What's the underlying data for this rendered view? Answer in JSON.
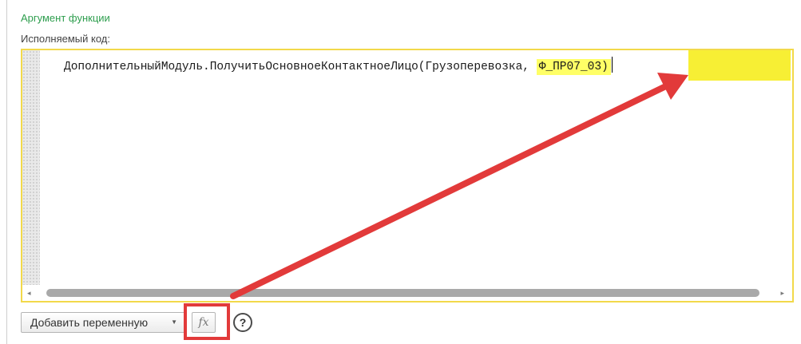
{
  "group_title": "Аргумент функции",
  "field_label": "Исполняемый код:",
  "editor": {
    "code_before": "ДополнительныйМодуль.ПолучитьОсновноеКонтактноеЛицо(Грузоперевозка, ",
    "code_highlight": "Ф_ПР07_03)"
  },
  "scrollbar": {
    "left_arrow": "◂",
    "right_arrow": "▸"
  },
  "toolbar": {
    "add_variable_label": "Добавить переменную",
    "dropdown_arrow": "▼",
    "fx_label": "fx",
    "help_label": "?"
  },
  "colors": {
    "title_green": "#2e9e4e",
    "editor_border": "#f2d94a",
    "highlight_yellow": "#f7ef34",
    "annotation_red": "#e23a3a",
    "scroll_thumb": "#a9a9a9"
  }
}
